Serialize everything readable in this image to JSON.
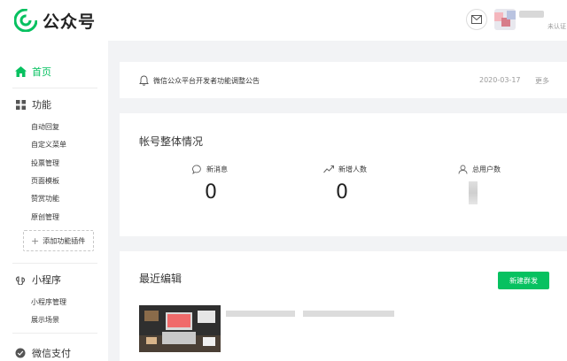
{
  "header": {
    "brand": "公众号",
    "verify_label": "未认证"
  },
  "sidebar": {
    "home": "首页",
    "functions": {
      "label": "功能",
      "items": [
        "自动回复",
        "自定义菜单",
        "投票管理",
        "页面模板",
        "赞赏功能",
        "原创管理"
      ],
      "add_plugin": "添加功能插件"
    },
    "mini_program": {
      "label": "小程序",
      "items": [
        "小程序管理",
        "展示场景"
      ]
    },
    "wechat_pay": "微信支付"
  },
  "notice": {
    "text": "微信公众平台开发者功能调整公告",
    "date": "2020-03-17",
    "more": "更多"
  },
  "overview": {
    "title": "帐号整体情况",
    "stats": [
      {
        "label": "新消息",
        "value": "0",
        "icon": "message-icon"
      },
      {
        "label": "新增人数",
        "value": "0",
        "icon": "trend-icon"
      },
      {
        "label": "总用户数",
        "value": "",
        "icon": "user-icon"
      }
    ]
  },
  "recent": {
    "title": "最近编辑",
    "new_button": "新建群发"
  },
  "colors": {
    "accent": "#07c160",
    "background": "#f2f3f5"
  }
}
